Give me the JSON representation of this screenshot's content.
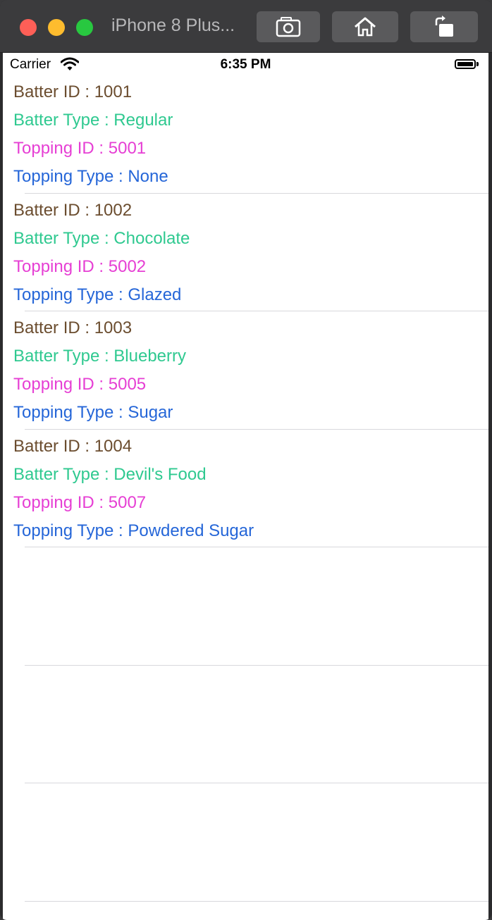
{
  "window": {
    "title": "iPhone 8 Plus...",
    "buttons": {
      "screenshot_icon": "camera-icon",
      "home_icon": "home-icon",
      "rotate_icon": "rotate-icon"
    }
  },
  "status_bar": {
    "carrier": "Carrier",
    "time": "6:35 PM"
  },
  "items": [
    {
      "batter_id": "Batter ID : 1001",
      "batter_type": "Batter Type : Regular",
      "topping_id": "Topping ID : 5001",
      "topping_type": "Topping Type : None"
    },
    {
      "batter_id": "Batter ID : 1002",
      "batter_type": "Batter Type : Chocolate",
      "topping_id": "Topping ID : 5002",
      "topping_type": "Topping Type : Glazed"
    },
    {
      "batter_id": "Batter ID : 1003",
      "batter_type": "Batter Type : Blueberry",
      "topping_id": "Topping ID : 5005",
      "topping_type": "Topping Type : Sugar"
    },
    {
      "batter_id": "Batter ID : 1004",
      "batter_type": "Batter Type : Devil's Food",
      "topping_id": "Topping ID : 5007",
      "topping_type": "Topping Type : Powdered Sugar"
    }
  ],
  "colors": {
    "batter_id": "#6b4d2f",
    "batter_type": "#2fc990",
    "topping_id": "#e63fd4",
    "topping_type": "#2566d8"
  }
}
